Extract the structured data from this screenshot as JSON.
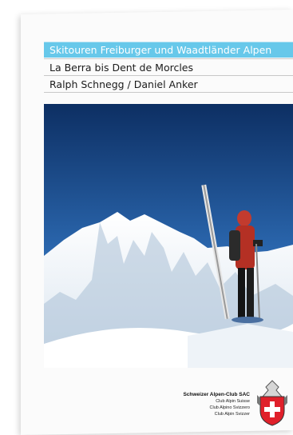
{
  "book": {
    "title": "Skitouren Freiburger und Waadtländer Alpen",
    "subtitle": "La Berra bis Dent de Morcles",
    "authors": "Ralph Schnegg / Daniel Anker",
    "publisher": {
      "name": "Schweizer Alpen-Club SAC",
      "lines": [
        "Club Alpin Suisse",
        "Club Alpino Svizzero",
        "Club Alpin Svizzer"
      ]
    },
    "title_band_color": "#67c8ea",
    "logo_icon": "sac-crest-icon"
  }
}
